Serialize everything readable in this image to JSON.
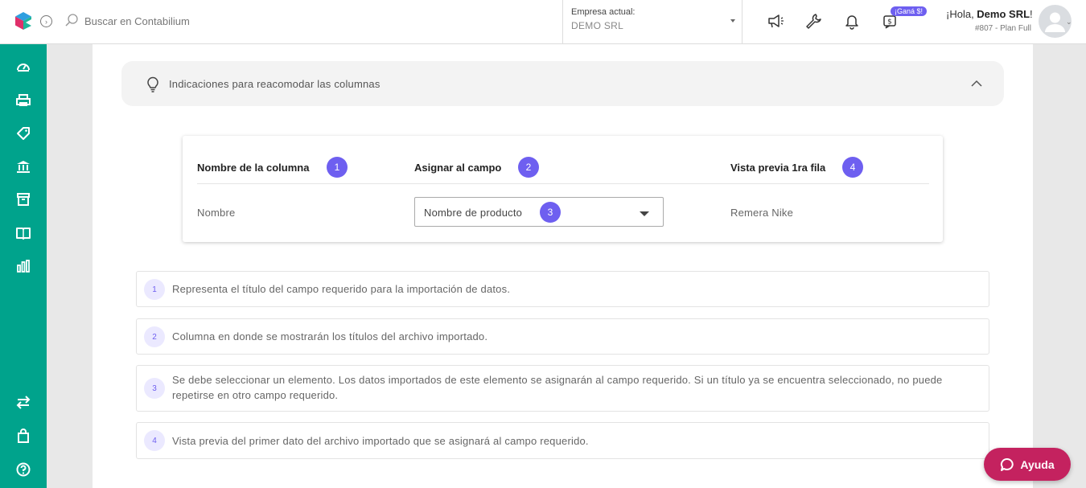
{
  "header": {
    "search_placeholder": "Buscar en Contabilium",
    "company_label": "Empresa actual:",
    "company_value": "DEMO SRL",
    "badge": "¡Ganá $!",
    "greeting_prefix": "¡Hola, ",
    "user_name": "Demo SRL",
    "greeting_suffix": "!",
    "plan": "#807 - Plan Full"
  },
  "sidebar": {
    "items": [
      "dashboard-icon",
      "printer-icon",
      "tag-icon",
      "bank-icon",
      "box-icon",
      "book-icon",
      "chart-icon"
    ],
    "bottom_items": [
      "transfer-icon",
      "bag-icon",
      "help-icon"
    ]
  },
  "hints": {
    "title": "Indicaciones para reacomodar las columnas"
  },
  "mapping_card": {
    "columns": [
      {
        "label": "Nombre de la columna",
        "num": "1"
      },
      {
        "label": "Asignar al campo",
        "num": "2"
      },
      {
        "label": "Vista previa 1ra fila",
        "num": "4"
      }
    ],
    "row": {
      "column_name": "Nombre",
      "field_value": "Nombre de producto",
      "field_num": "3",
      "preview": "Remera Nike"
    }
  },
  "notes": [
    {
      "num": "1",
      "text": "Representa el título del campo requerido para la importación de datos."
    },
    {
      "num": "2",
      "text": "Columna en donde se mostrarán los títulos del archivo importado."
    },
    {
      "num": "3",
      "text": "Se debe seleccionar un elemento. Los datos importados de este elemento se asignarán al campo requerido. Si un título ya se encuentra seleccionado, no puede repetirse en otro campo requerido."
    },
    {
      "num": "4",
      "text": "Vista previa del primer dato del archivo importado que se asignará al campo requerido."
    }
  ],
  "help": {
    "label": "Ayuda"
  },
  "colors": {
    "brand": "#00a38c",
    "accent": "#6e5ff0",
    "help": "#c4225f"
  }
}
